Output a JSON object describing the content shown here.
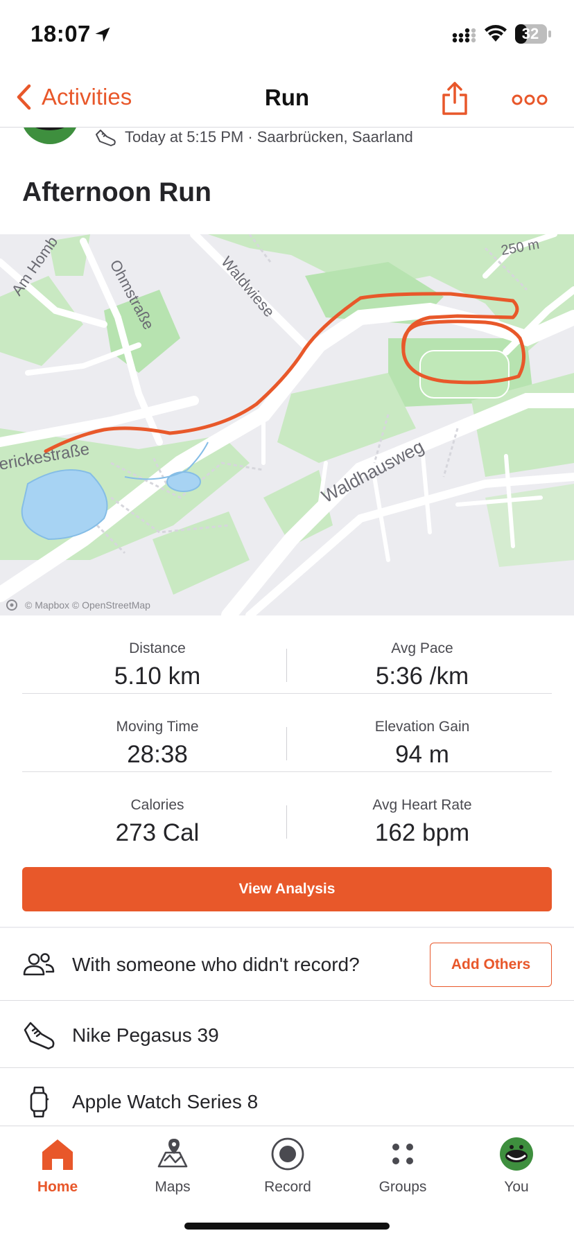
{
  "status_bar": {
    "time": "18:07",
    "battery": "32"
  },
  "nav": {
    "back_label": "Activities",
    "title": "Run"
  },
  "activity": {
    "meta": "Today at 5:15 PM · Saarbrücken, Saarland",
    "title": "Afternoon Run"
  },
  "map": {
    "labels": [
      "Am Homb",
      "Ohmstraße",
      "Waldwiese",
      "erickestraße",
      "Waldhausweg",
      "250 m"
    ],
    "credit": "© Mapbox © OpenStreetMap"
  },
  "stats": [
    {
      "label": "Distance",
      "value": "5.10 km"
    },
    {
      "label": "Avg Pace",
      "value": "5:36 /km"
    },
    {
      "label": "Moving Time",
      "value": "28:38"
    },
    {
      "label": "Elevation Gain",
      "value": "94 m"
    },
    {
      "label": "Calories",
      "value": "273 Cal"
    },
    {
      "label": "Avg Heart Rate",
      "value": "162 bpm"
    }
  ],
  "view_analysis": "View Analysis",
  "with_others": {
    "text": "With someone who didn't record?",
    "button": "Add Others"
  },
  "gear": "Nike Pegasus 39",
  "device": "Apple Watch Series 8",
  "tabs": [
    {
      "label": "Home",
      "icon": "home-icon"
    },
    {
      "label": "Maps",
      "icon": "maps-icon"
    },
    {
      "label": "Record",
      "icon": "record-icon"
    },
    {
      "label": "Groups",
      "icon": "groups-icon"
    },
    {
      "label": "You",
      "icon": "avatar-icon"
    }
  ],
  "colors": {
    "accent": "#e8572a",
    "route": "#e8582a",
    "water": "#a7d3f3",
    "park": "#b7e3b0"
  }
}
